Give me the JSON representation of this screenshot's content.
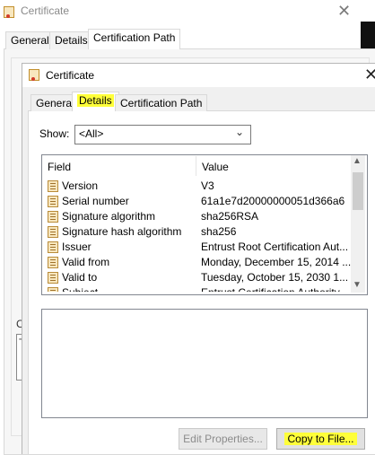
{
  "back_window": {
    "title": "Certificate",
    "close": "✕",
    "tabs": [
      "General",
      "Details",
      "Certification Path"
    ],
    "active_tab": "Certification Path",
    "fragment_label": "C",
    "fragment_text": "T"
  },
  "front_window": {
    "title": "Certificate",
    "close": "✕",
    "tabs": [
      "General",
      "Details",
      "Certification Path"
    ],
    "active_tab": "Details",
    "show_label": "Show:",
    "show_value": "<All>",
    "columns": {
      "field": "Field",
      "value": "Value"
    },
    "rows": [
      {
        "field": "Version",
        "value": "V3"
      },
      {
        "field": "Serial number",
        "value": "61a1e7d20000000051d366a6"
      },
      {
        "field": "Signature algorithm",
        "value": "sha256RSA"
      },
      {
        "field": "Signature hash algorithm",
        "value": "sha256"
      },
      {
        "field": "Issuer",
        "value": "Entrust Root Certification Aut..."
      },
      {
        "field": "Valid from",
        "value": "Monday, December 15, 2014 ..."
      },
      {
        "field": "Valid to",
        "value": "Tuesday, October 15, 2030 1..."
      },
      {
        "field": "Subject",
        "value": "Entrust Certification Authority..."
      }
    ],
    "buttons": {
      "edit_properties": "Edit Properties...",
      "copy_to_file": "Copy to File..."
    }
  },
  "colors": {
    "highlight": "#ffff3a",
    "window_bg": "#f0f0f0",
    "border": "#828790"
  },
  "icons": {
    "title_icon": "certificate-icon",
    "row_icon": "certificate-field-icon",
    "dropdown": "chevron-down-icon"
  }
}
